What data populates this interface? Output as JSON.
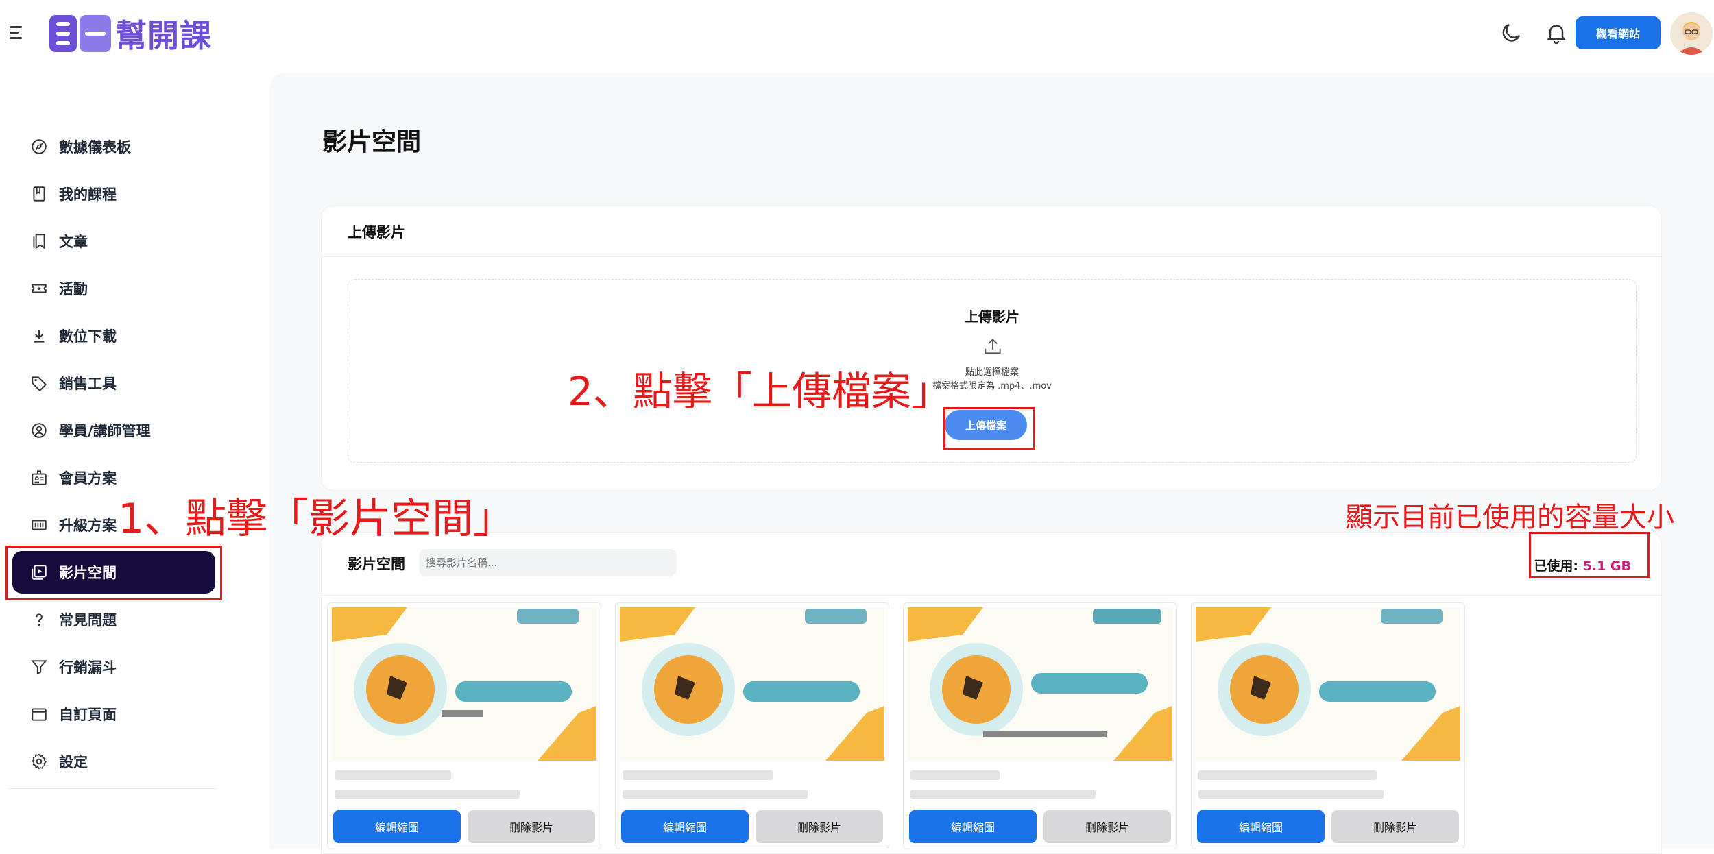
{
  "header": {
    "logo_text": "幫開課",
    "menu_icon": "hamburger-menu-icon",
    "theme_icon": "moon-icon",
    "notification_icon": "bell-icon",
    "view_site_label": "觀看網站",
    "avatar_icon": "user-avatar"
  },
  "sidebar": {
    "items": [
      {
        "label": "數據儀表板",
        "icon": "compass-icon"
      },
      {
        "label": "我的課程",
        "icon": "book-icon"
      },
      {
        "label": "文章",
        "icon": "bookmark-doc-icon"
      },
      {
        "label": "活動",
        "icon": "ticket-icon"
      },
      {
        "label": "數位下載",
        "icon": "download-icon"
      },
      {
        "label": "銷售工具",
        "icon": "tag-icon"
      },
      {
        "label": "學員/講師管理",
        "icon": "user-circle-icon"
      },
      {
        "label": "會員方案",
        "icon": "id-badge-icon"
      },
      {
        "label": "升級方案",
        "icon": "plan-icon"
      },
      {
        "label": "影片空間",
        "icon": "video-library-icon"
      },
      {
        "label": "常見問題",
        "icon": "question-icon"
      },
      {
        "label": "行銷漏斗",
        "icon": "funnel-icon"
      },
      {
        "label": "自訂頁面",
        "icon": "window-icon"
      },
      {
        "label": "設定",
        "icon": "gear-icon"
      }
    ],
    "active_item": "影片空間"
  },
  "main": {
    "page_title": "影片空間",
    "upload_card": {
      "header": "上傳影片",
      "dropzone_title": "上傳影片",
      "hint_click": "點此選擇檔案",
      "hint_format": "檔案格式限定為 .mp4、.mov",
      "upload_button": "上傳檔案",
      "upload_icon": "upload-icon"
    },
    "videos": {
      "title": "影片空間",
      "search_placeholder": "搜尋影片名稱...",
      "usage_label": "已使用: ",
      "usage_value": "5.1 GB",
      "cards": [
        {
          "edit_label": "編輯縮圖",
          "delete_label": "刪除影片"
        },
        {
          "edit_label": "編輯縮圖",
          "delete_label": "刪除影片"
        },
        {
          "edit_label": "編輯縮圖",
          "delete_label": "刪除影片"
        },
        {
          "edit_label": "編輯縮圖",
          "delete_label": "刪除影片"
        }
      ]
    }
  },
  "annotations": {
    "step1": "1、點擊「影片空間」",
    "step2": "2、點擊「上傳檔案」",
    "usage_note": "顯示目前已使用的容量大小",
    "color": "#e41b1b"
  },
  "colors": {
    "accent_blue": "#1a73e8",
    "active_nav": "#160b3a",
    "usage_value": "#d01b7a",
    "logo": "#6d4fd8"
  }
}
